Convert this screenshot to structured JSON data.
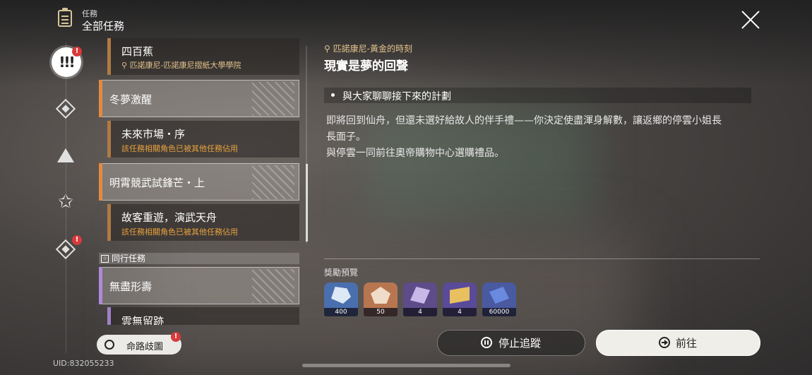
{
  "header": {
    "section": "任務",
    "title": "全部任務"
  },
  "quest_list": {
    "items": [
      {
        "kind": "sub",
        "title": "四百蕉",
        "subtitle": "匹諾康尼-匹諾康尼摺紙大學學院",
        "subtitle_color": "#e2c28c",
        "bar": "#b07a45"
      },
      {
        "kind": "main",
        "title": "冬夢激醒"
      },
      {
        "kind": "sub",
        "title": "未來市場・序",
        "subtitle": "該任務相關角色已被其他任務佔用",
        "subtitle_color": "#e8a23d",
        "bar": "#b07a45"
      },
      {
        "kind": "main",
        "title": "明霄競武試鋒芒・上"
      },
      {
        "kind": "sub",
        "title": "故客重遊，演武天舟",
        "subtitle": "該任務相關角色已被其他任務佔用",
        "subtitle_color": "#e8a23d",
        "bar": "#b07a45"
      },
      {
        "kind": "main",
        "title": "無盡形壽"
      },
      {
        "kind": "sub",
        "title": "雲無留跡",
        "bar": "#9f80c8"
      }
    ],
    "companion_header": "同行任務"
  },
  "detail": {
    "location": "匹諾康尼-黃金的時刻",
    "title": "現實是夢的回聲",
    "objective": "與大家聊聊接下來的計劃",
    "description_lines": [
      "即將回到仙舟，但還未選好給故人的伴手禮——你決定使盡渾身解數，讓返鄉的停雲小姐長",
      "長面子。",
      "與停雲一同前往奧帝購物中心選購禮品。"
    ],
    "reward_label": "獎勵預覽",
    "rewards": [
      {
        "name": "crystal-reward",
        "count": "400",
        "bg": "#4a6fae",
        "art": "#dde8f5"
      },
      {
        "name": "ore-reward",
        "count": "50",
        "bg": "#b87650",
        "art": "#f0dcc8"
      },
      {
        "name": "material-reward",
        "count": "4",
        "bg": "#5d4b8a",
        "art": "#c8b8e8"
      },
      {
        "name": "book-reward",
        "count": "4",
        "bg": "#5a4a9a",
        "art": "#e8c060"
      },
      {
        "name": "credit-reward",
        "count": "60000",
        "bg": "#4a5aa0",
        "art": "#6a8ae0"
      }
    ]
  },
  "buttons": {
    "stop_tracking": "停止追蹤",
    "go": "前往",
    "path_map": "命路歧圖"
  },
  "badges": {
    "rail_active": "!",
    "rail_bottom": "!",
    "path_map": "!"
  },
  "rail": {
    "active_glyph": "!!!"
  },
  "uid": "UID:832055233",
  "colors": {
    "accent_orange": "#e38a40",
    "accent_purple": "#b08ad8",
    "location_gold": "#e2c28c",
    "warning_orange": "#e8a23d",
    "badge_red": "#d83a3a"
  }
}
